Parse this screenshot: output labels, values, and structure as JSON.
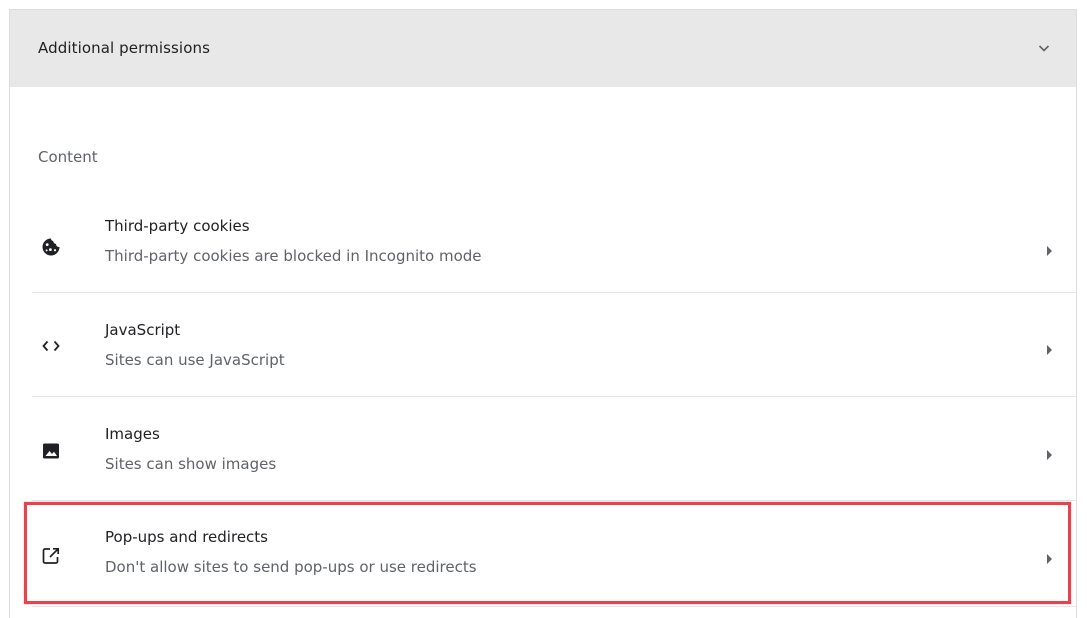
{
  "header": {
    "title": "Additional permissions",
    "chevron_icon": "chevron-down-icon"
  },
  "section": {
    "title": "Content"
  },
  "rows": [
    {
      "title": "Third-party cookies",
      "subtitle": "Third-party cookies are blocked in Incognito mode",
      "icon": "cookie-icon"
    },
    {
      "title": "JavaScript",
      "subtitle": "Sites can use JavaScript",
      "icon": "code-icon"
    },
    {
      "title": "Images",
      "subtitle": "Sites can show images",
      "icon": "image-icon"
    },
    {
      "title": "Pop-ups and redirects",
      "subtitle": "Don't allow sites to send pop-ups or use redirects",
      "icon": "popup-icon"
    }
  ],
  "colors": {
    "highlight": "#e8434b",
    "header_bg": "#e8e8e8"
  }
}
